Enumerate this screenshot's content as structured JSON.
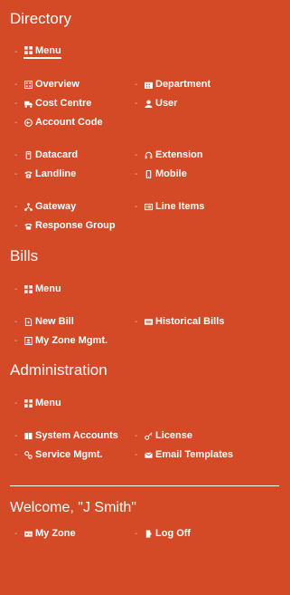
{
  "theme": {
    "background": "#d44a27",
    "text": "#ffffff"
  },
  "directory": {
    "title": "Directory",
    "menu": "Menu",
    "overview": "Overview",
    "department": "Department",
    "cost_centre": "Cost Centre",
    "user": "User",
    "account_code": "Account Code",
    "datacard": "Datacard",
    "extension": "Extension",
    "landline": "Landline",
    "mobile": "Mobile",
    "gateway": "Gateway",
    "line_items": "Line Items",
    "response_group": "Response Group"
  },
  "bills": {
    "title": "Bills",
    "menu": "Menu",
    "new_bill": "New Bill",
    "historical_bills": "Historical Bills",
    "my_zone_mgmt": "My Zone Mgmt."
  },
  "administration": {
    "title": "Administration",
    "menu": "Menu",
    "system_accounts": "System Accounts",
    "license": "License",
    "service_mgmt": "Service Mgmt.",
    "email_templates": "Email Templates"
  },
  "account": {
    "welcome": "Welcome, \"J Smith\"",
    "my_zone": "My Zone",
    "log_off": "Log Off"
  }
}
